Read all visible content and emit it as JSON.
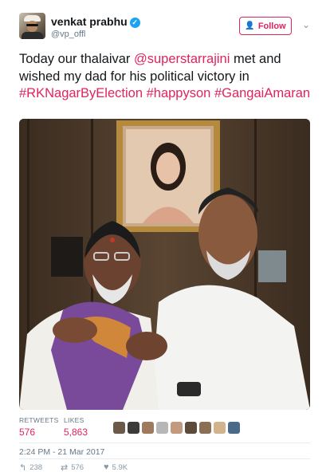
{
  "header": {
    "name": "venkat prabhu",
    "handle": "@vp_offl",
    "follow_label": "Follow",
    "verified_icon": "verified-badge-icon",
    "follow_color": "#e0245e"
  },
  "tweet": {
    "segments": [
      {
        "text": "Today our thalaivar ",
        "link": false
      },
      {
        "text": "@superstarrajini",
        "link": true
      },
      {
        "text": " met and wished my dad for his political victory in ",
        "link": false
      },
      {
        "text": "#RKNagarByElection",
        "link": true
      },
      {
        "text": " ",
        "link": false
      },
      {
        "text": "#happyson",
        "link": true
      },
      {
        "text": " ",
        "link": false
      },
      {
        "text": "#GangaiAmaran",
        "link": true
      }
    ],
    "link_color": "#e0245e"
  },
  "stats": {
    "retweets_label": "RETWEETS",
    "retweets_value": "576",
    "likes_label": "LIKES",
    "likes_value": "5,863",
    "liker_colors": [
      "#6b5a4a",
      "#3d3b3a",
      "#a07a5c",
      "#b7b7b7",
      "#c49a7e",
      "#5c4a3a",
      "#8a6f55",
      "#d2b48c",
      "#4a6a8a"
    ]
  },
  "timestamp": "2:24 PM - 21 Mar 2017",
  "actions": {
    "reply_count": "238",
    "retweet_count": "576",
    "like_count": "5.9K"
  }
}
